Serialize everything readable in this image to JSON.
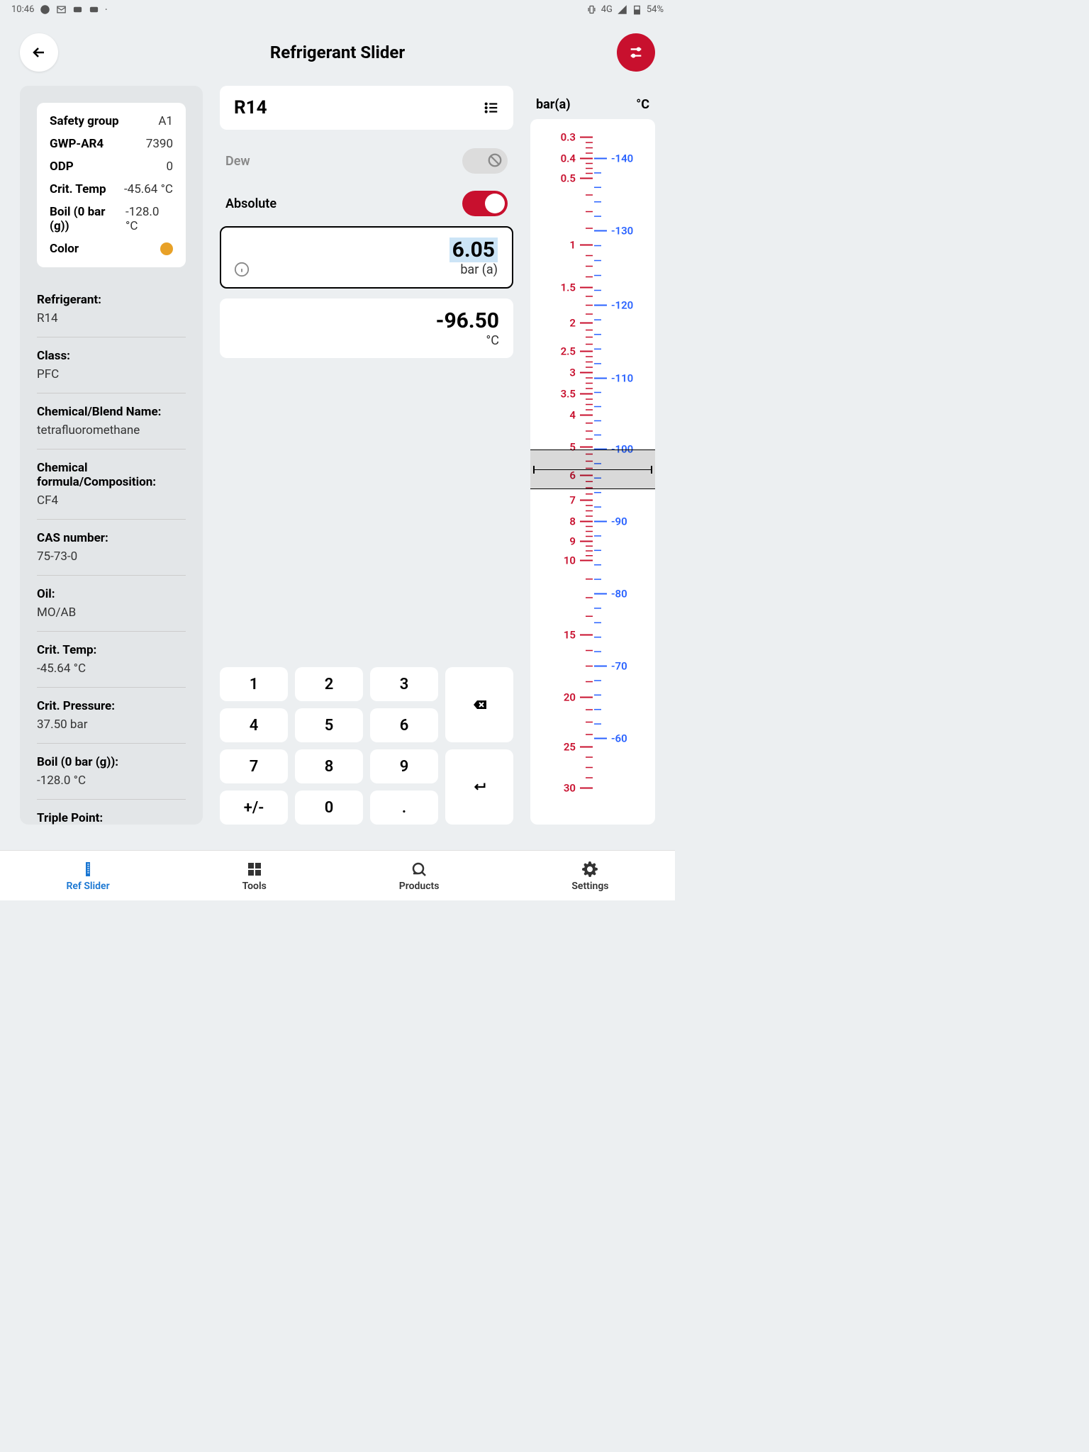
{
  "status": {
    "time": "10:46",
    "network": "4G",
    "battery": "54%"
  },
  "header": {
    "title": "Refrigerant Slider"
  },
  "properties": {
    "safety_group_label": "Safety group",
    "safety_group": "A1",
    "gwp_label": "GWP-AR4",
    "gwp": "7390",
    "odp_label": "ODP",
    "odp": "0",
    "crit_temp_label": "Crit. Temp",
    "crit_temp": "-45.64 °C",
    "boil_label": "Boil (0 bar (g))",
    "boil": "-128.0 °C",
    "color_label": "Color"
  },
  "info": {
    "refrigerant_label": "Refrigerant:",
    "refrigerant": "R14",
    "class_label": "Class:",
    "class": "PFC",
    "chemical_name_label": "Chemical/Blend Name:",
    "chemical_name": "tetrafluoromethane",
    "formula_label": "Chemical formula/Composition:",
    "formula": "CF4",
    "cas_label": "CAS number:",
    "cas": "75-73-0",
    "oil_label": "Oil:",
    "oil": "MO/AB",
    "ctemp_label": "Crit. Temp:",
    "ctemp": "-45.64 °C",
    "cpress_label": "Crit. Pressure:",
    "cpress": "37.50 bar",
    "boil2_label": "Boil (0 bar (g)):",
    "boil2": "-128.0 °C",
    "triple_label": "Triple Point:"
  },
  "center": {
    "refrigerant_name": "R14",
    "dew_label": "Dew",
    "absolute_label": "Absolute",
    "pressure_value": "6.05",
    "pressure_unit": "bar (a)",
    "temp_value": "-96.50",
    "temp_unit": "°C"
  },
  "keypad": {
    "k1": "1",
    "k2": "2",
    "k3": "3",
    "k4": "4",
    "k5": "5",
    "k6": "6",
    "k7": "7",
    "k8": "8",
    "k9": "9",
    "k0": "0",
    "sign": "+/-",
    "dot": "."
  },
  "ruler": {
    "left_label": "bar(a)",
    "right_label": "°C",
    "pressure_ticks": [
      "0.3",
      "0.4",
      "0.5",
      "1",
      "1.5",
      "2",
      "2.5",
      "3",
      "3.5",
      "4",
      "5",
      "6",
      "7",
      "8",
      "9",
      "10",
      "15",
      "20",
      "25",
      "30"
    ],
    "temp_ticks": [
      "-140",
      "-130",
      "-120",
      "-110",
      "-100",
      "-90",
      "-80",
      "-70",
      "-60"
    ]
  },
  "nav": {
    "ref_slider": "Ref Slider",
    "tools": "Tools",
    "products": "Products",
    "settings": "Settings"
  }
}
